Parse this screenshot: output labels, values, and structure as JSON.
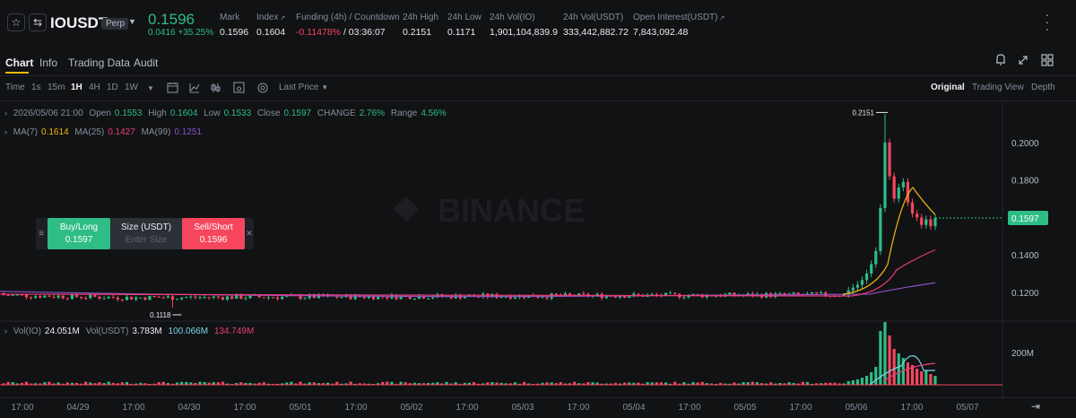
{
  "header": {
    "symbol": "IOUSDT",
    "contract_type": "Perp",
    "last_price": "0.1596",
    "change_abs": "0.0416",
    "change_pct": "+35.25%",
    "stats": [
      {
        "label": "Mark",
        "value": "0.1596"
      },
      {
        "label": "Index",
        "value": "0.1604"
      },
      {
        "label": "Funding (4h) / Countdown",
        "value": "-0.11478%",
        "value2": "/ 03:36:07"
      },
      {
        "label": "24h High",
        "value": "0.2151"
      },
      {
        "label": "24h Low",
        "value": "0.1171"
      },
      {
        "label": "24h Vol(IO)",
        "value": "1,901,104,839.9"
      },
      {
        "label": "24h Vol(USDT)",
        "value": "333,442,882.72"
      },
      {
        "label": "Open Interest(USDT)",
        "value": "7,843,092.48"
      }
    ]
  },
  "tabs": [
    "Chart",
    "Info",
    "Trading Data",
    "Audit"
  ],
  "toolbar": {
    "time_label": "Time",
    "intervals": [
      "1s",
      "15m",
      "1H",
      "4H",
      "1D",
      "1W"
    ],
    "active_interval": "1H",
    "price_type": "Last Price",
    "views": [
      "Original",
      "Trading View",
      "Depth"
    ],
    "active_view": "Original"
  },
  "ohlc": {
    "datetime": "2026/05/06 21:00",
    "open_label": "Open",
    "open": "0.1553",
    "high_label": "High",
    "high": "0.1604",
    "low_label": "Low",
    "low": "0.1533",
    "close_label": "Close",
    "close": "0.1597",
    "change_label": "CHANGE",
    "change": "2.76%",
    "range_label": "Range",
    "range": "4.56%"
  },
  "ma": {
    "ma7_label": "MA(7)",
    "ma7": "0.1614",
    "ma25_label": "MA(25)",
    "ma25": "0.1427",
    "ma99_label": "MA(99)",
    "ma99": "0.1251"
  },
  "volume": {
    "io_label": "Vol(IO)",
    "io": "24.051M",
    "usdt_label": "Vol(USDT)",
    "usdt": "3.783M",
    "ma1": "100.066M",
    "ma2": "134.749M"
  },
  "order_panel": {
    "buy_label": "Buy/Long",
    "buy_price": "0.1597",
    "size_label": "Size (USDT)",
    "size_placeholder": "Enter Size",
    "sell_label": "Sell/Short",
    "sell_price": "0.1596"
  },
  "watermark": "BINANCE",
  "colors": {
    "up": "#2ebd85",
    "down": "#f6465d",
    "ma7": "#f0b90b",
    "ma25": "#ea3d79",
    "ma99": "#8c53c4",
    "accent": "#f0b90b"
  },
  "chart_data": {
    "type": "candlestick",
    "ylim": [
      0.107,
      0.222
    ],
    "y_ticks": [
      "0.2000",
      "0.1800",
      "0.1600",
      "0.1400",
      "0.1200"
    ],
    "y_tick_values": [
      0.2,
      0.18,
      0.16,
      0.14,
      0.12
    ],
    "x_labels": [
      "17:00",
      "04/29",
      "17:00",
      "04/30",
      "17:00",
      "05/01",
      "17:00",
      "05/02",
      "17:00",
      "05/03",
      "17:00",
      "05/04",
      "17:00",
      "05/05",
      "17:00",
      "05/06",
      "17:00",
      "05/07"
    ],
    "current_price": "0.1597",
    "high_marker": "0.2151",
    "low_marker": "0.1118",
    "volume_tick": "200M",
    "ma_series": [
      {
        "name": "MA(7)",
        "values": [
          0.12,
          0.13,
          0.15,
          0.17,
          0.176,
          0.17,
          0.164,
          0.161
        ]
      },
      {
        "name": "MA(25)",
        "values": [
          0.119,
          0.121,
          0.128,
          0.133,
          0.136,
          0.139,
          0.142
        ]
      },
      {
        "name": "MA(99)",
        "values": [
          0.118,
          0.118,
          0.119,
          0.121,
          0.123,
          0.125
        ]
      }
    ]
  }
}
